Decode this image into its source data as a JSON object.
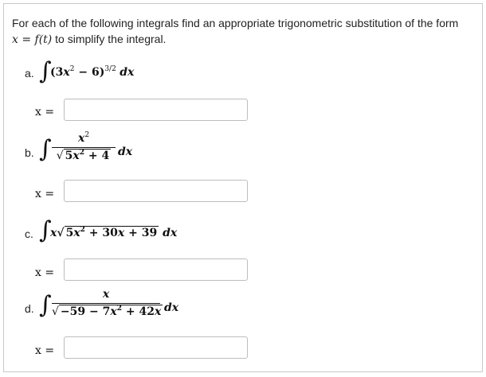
{
  "intro": {
    "line1": "For each of the following integrals find an appropriate trigonometric substitution of the form",
    "line2_math": "x = f(t)",
    "line2_rest": " to simplify the integral."
  },
  "parts": [
    {
      "letter": "a.",
      "integral_sign": "∫",
      "integrand": "(3x² − 6)^{3/2} dx",
      "base": "(3",
      "var": "x",
      "sq": "2",
      "minus": " − 6)",
      "power": "3/2",
      "dx": "dx",
      "eq_label": "x =",
      "answer_value": ""
    },
    {
      "letter": "b.",
      "integral_sign": "∫",
      "numerator": "x²",
      "num_var": "x",
      "num_sq": "2",
      "sqrt_symbol": "√",
      "den_text": "5x² + 4",
      "den_a": "5",
      "den_var": "x",
      "den_sq": "2",
      "den_b": " + 4",
      "dx": "dx",
      "eq_label": "x =",
      "answer_value": ""
    },
    {
      "letter": "c.",
      "integral_sign": "∫",
      "var": "x",
      "sqrt_symbol": "√",
      "rad_a": "5",
      "rad_var": "x",
      "rad_sq": "2",
      "rad_b": " + 30",
      "rad_var2": "x",
      "rad_c": " + 39",
      "dx": "dx",
      "eq_label": "x =",
      "answer_value": ""
    },
    {
      "letter": "d.",
      "integral_sign": "∫",
      "numerator": "x",
      "sqrt_symbol": "√",
      "den_a": "−59 − 7",
      "den_var": "x",
      "den_sq": "2",
      "den_b": " + 42",
      "den_var2": "x",
      "dx": "dx",
      "eq_label": "x =",
      "answer_value": ""
    }
  ]
}
